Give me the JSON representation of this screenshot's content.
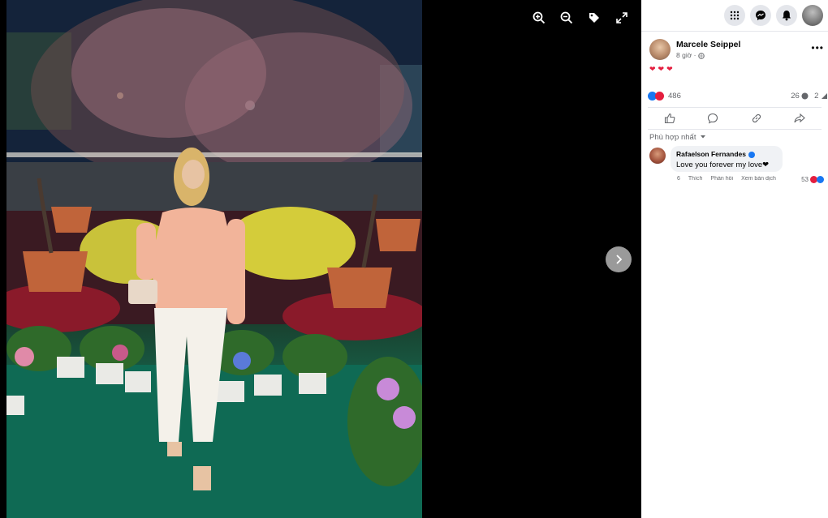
{
  "viewer": {
    "icons": [
      "zoom-in-icon",
      "zoom-out-icon",
      "tag-icon",
      "fullscreen-icon"
    ],
    "next_icon": "chevron-right-icon"
  },
  "topbar": {
    "icons": [
      "menu-grid-icon",
      "messenger-icon",
      "bell-icon",
      "profile-avatar"
    ]
  },
  "post": {
    "author": "Marcele Seippel",
    "time": "8 giờ ·",
    "caption": "❤❤❤",
    "reaction_count": "486",
    "comment_count": "26",
    "share_count": "2",
    "actions": [
      "like",
      "comment",
      "share-link",
      "send"
    ]
  },
  "comments": {
    "sort_label": "Phù hợp nhất",
    "items": [
      {
        "author": "Rafaelson Fernandes",
        "text": "Love you forever my love❤",
        "time": "6",
        "like": "Thích",
        "reply": "Phản hồi",
        "see_translation": "Xem bản dịch",
        "reactions": "53"
      }
    ]
  },
  "colors": {
    "viewer_bg": "#000000",
    "panel_bg": "#ffffff",
    "accent": "#1877f2",
    "heart": "#e41e3f",
    "carpet": "#0f5b48"
  }
}
